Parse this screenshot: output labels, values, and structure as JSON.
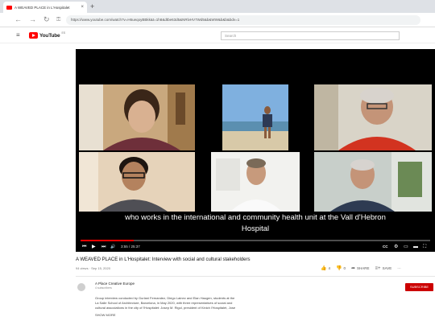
{
  "browser": {
    "tab_title": "A WEAVED PLACE in L'Hospitalet",
    "tab_close": "×",
    "new_tab": "+",
    "url": "https://www.youtube.com/watch?v=H6ueqoyBBkk&t=1h8&dtbe63d5&NRlvHV7Wd5&b&WW&b&b&bdv=1",
    "back_icon": "←",
    "forward_icon": "→",
    "reload_icon": "↻",
    "lock_icon": "⚿"
  },
  "youtube": {
    "menu_icon": "≡",
    "logo_text": "YouTube",
    "logo_region": "ES",
    "search_placeholder": "Search",
    "search_icon": "⌕"
  },
  "player": {
    "caption_lines": [
      "who works in the international and community health unit at the Vall d'Hebron",
      "Hospital"
    ],
    "time": "3:55 / 25:37",
    "progress": 0.153,
    "controls": {
      "prev": "⏮",
      "play": "▶",
      "next": "⏭",
      "volume": "🔊",
      "subtitles": "CC",
      "settings": "⚙",
      "miniplayer": "▭",
      "theater": "▬",
      "fullscreen": "⛶"
    }
  },
  "video": {
    "title": "A WEAVED PLACE in L'Hospitalet: Interview with social and cultural stakeholders",
    "meta": "94 views · Sep 15, 2020",
    "actions": [
      {
        "icon": "👍",
        "label": "4"
      },
      {
        "icon": "👎",
        "label": "0"
      },
      {
        "icon": "➦",
        "label": "SHARE"
      },
      {
        "icon": "≡+",
        "label": "SAVE"
      },
      {
        "icon": "",
        "label": "···"
      }
    ]
  },
  "channel": {
    "name": "A Place Creative Europe",
    "subscribers": "4 subscribers",
    "subscribe_label": "SUBSCRIBE"
  },
  "description": {
    "lines": [
      "Group interview conducted by Gurlani Fernandez, Diego Lainez and Elan Haugen, students at the",
      "La Salle School of Architecture, Barcelona, in May 2020, with three representatives of social and",
      "cultural associations in the city of l'Hospitalet: Josep M. Rigol, president of Kinich l'Hospitalet, Jose",
      "SHOW MORE"
    ]
  },
  "colors": {
    "brand_red": "#ff0000",
    "subscribe_red": "#cc0000",
    "player_bg": "#000000"
  }
}
